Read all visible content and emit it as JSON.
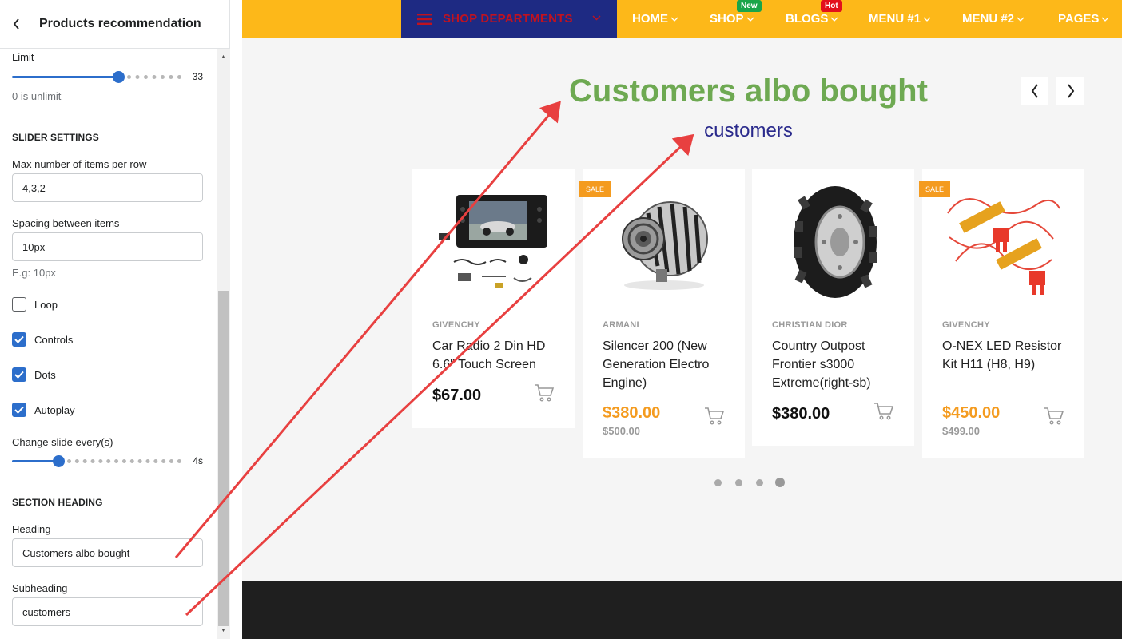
{
  "panel": {
    "title": "Products recommendation",
    "limit": {
      "label": "Limit",
      "value": "33",
      "fraction": 0.64,
      "help": "0 is unlimit"
    },
    "slider_settings": {
      "section_title": "SLIDER SETTINGS",
      "max_items_label": "Max number of items per row",
      "max_items_value": "4,3,2",
      "spacing_label": "Spacing between items",
      "spacing_value": "10px",
      "spacing_help": "E.g: 10px",
      "loop": {
        "label": "Loop",
        "checked": false
      },
      "controls": {
        "label": "Controls",
        "checked": true
      },
      "dots": {
        "label": "Dots",
        "checked": true
      },
      "autoplay": {
        "label": "Autoplay",
        "checked": true
      },
      "change_slide_label": "Change slide every(s)",
      "change_slide_value": "4s",
      "change_slide_fraction": 0.26
    },
    "section_heading": {
      "section_title": "SECTION HEADING",
      "heading_label": "Heading",
      "heading_value": "Customers albo bought",
      "subheading_label": "Subheading",
      "subheading_value": "customers"
    }
  },
  "preview": {
    "nav": {
      "departments": "SHOP DEPARTMENTS",
      "items": [
        {
          "label": "HOME"
        },
        {
          "label": "SHOP",
          "badge": "New",
          "badge_color": "#1aa54a"
        },
        {
          "label": "BLOGS",
          "badge": "Hot",
          "badge_color": "#e3101b"
        },
        {
          "label": "MENU #1"
        },
        {
          "label": "MENU #2"
        },
        {
          "label": "PAGES"
        }
      ]
    },
    "heading": "Customers albo bought",
    "subheading": "customers",
    "products": [
      {
        "brand": "GIVENCHY",
        "name": "Car Radio 2 Din HD 6.6\" Touch Screen",
        "price": "$67.00",
        "old_price": "",
        "sale": false,
        "image": "car-radio"
      },
      {
        "brand": "ARMANI",
        "name": "Silencer 200 (New Generation Electro Engine)",
        "price": "$380.00",
        "old_price": "$500.00",
        "sale": true,
        "sale_label": "SALE",
        "image": "alternator"
      },
      {
        "brand": "CHRISTIAN DIOR",
        "name": "Country Outpost Frontier s3000 Extreme(right-sb)",
        "price": "$380.00",
        "old_price": "",
        "sale": false,
        "image": "tire"
      },
      {
        "brand": "GIVENCHY",
        "name": "O-NEX LED Resistor Kit H11 (H8, H9)",
        "price": "$450.00",
        "old_price": "$499.00",
        "sale": true,
        "sale_label": "SALE",
        "image": "resistor-kit"
      }
    ],
    "dots": {
      "count": 4,
      "active_index": 3
    }
  },
  "colors": {
    "accent": "#2c6ecb",
    "nav_bg": "#fdb819",
    "dept_bg": "#1e2a83",
    "heading": "#6ea952",
    "subheading": "#2a2a8c",
    "sale_price": "#f49b1f",
    "annotation_arrow": "#e84040"
  }
}
